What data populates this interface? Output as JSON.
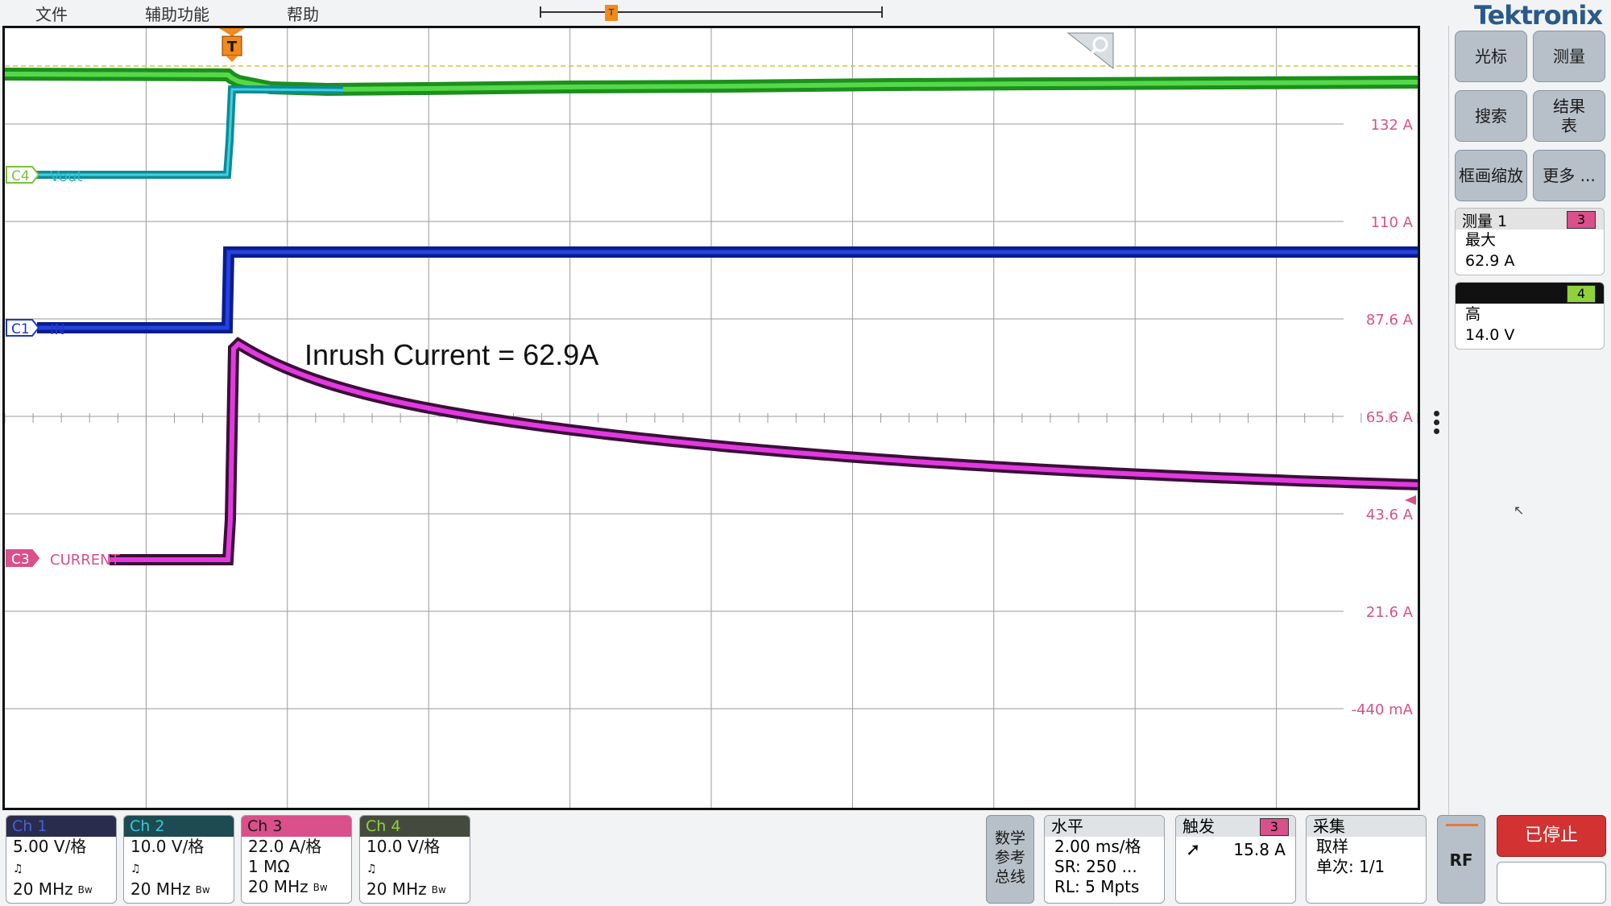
{
  "menu": {
    "file": "文件",
    "utility": "辅助功能",
    "help": "帮助"
  },
  "brand": {
    "logo": "Tektronix"
  },
  "trigger_marker": "T",
  "scope": {
    "annotation": "Inrush Current = 62.9A",
    "channel_labels": [
      {
        "id": "C4",
        "name": "Vout",
        "color": "#7cc23a",
        "text_color": "#2bb7c8"
      },
      {
        "id": "C1",
        "name": "IN",
        "color": "#1f37c9",
        "text_color": "#1f37c9"
      },
      {
        "id": "C3",
        "name": "CURRENT",
        "color": "#d9508a",
        "text_color": "#d9508a"
      }
    ],
    "scale_labels": [
      "132 A",
      "110 A",
      "87.6 A",
      "65.6 A",
      "43.6 A",
      "21.6 A",
      "-440 mA"
    ]
  },
  "side_buttons": {
    "cursor": "光标",
    "measure": "测量",
    "search": "搜索",
    "results_table_1": "结果",
    "results_table_2": "表",
    "zoom": "框画缩放",
    "more": "更多 ..."
  },
  "measurements": [
    {
      "title": "测量 1",
      "badge": "3",
      "type": "最大",
      "value": "62.9 A"
    },
    {
      "title": "",
      "badge": "4",
      "type": "高",
      "value": "14.0 V"
    }
  ],
  "channels": [
    {
      "label": "Ch 1",
      "scale": "5.00 V/格",
      "impedance": "",
      "bandwidth": "20 MHz",
      "color": "#2a2c4d",
      "label_color": "#4960d8"
    },
    {
      "label": "Ch 2",
      "scale": "10.0 V/格",
      "impedance": "",
      "bandwidth": "20 MHz",
      "color": "#1e4a52",
      "label_color": "#3ec7d6"
    },
    {
      "label": "Ch 3",
      "scale": "22.0 A/格",
      "impedance": "1 MΩ",
      "bandwidth": "20 MHz",
      "color": "#d9508a",
      "label_color": "#1a1a1a"
    },
    {
      "label": "Ch 4",
      "scale": "10.0 V/格",
      "impedance": "",
      "bandwidth": "20 MHz",
      "color": "#444b3e",
      "label_color": "#8fd23e"
    }
  ],
  "bw_mark": "Bw",
  "math_ref_bus": {
    "line1": "数学",
    "line2": "参考",
    "line3": "总线"
  },
  "horizontal": {
    "title": "水平",
    "scale": "2.00 ms/格",
    "sr": "SR: 250 ...",
    "rl": "RL: 5 Mpts"
  },
  "trigger": {
    "title": "触发",
    "badge": "3",
    "level": "15.8 A"
  },
  "acquire": {
    "title": "采集",
    "mode": "取样",
    "count": "单次: 1/1"
  },
  "rf": "RF",
  "run_state": "已停止"
}
